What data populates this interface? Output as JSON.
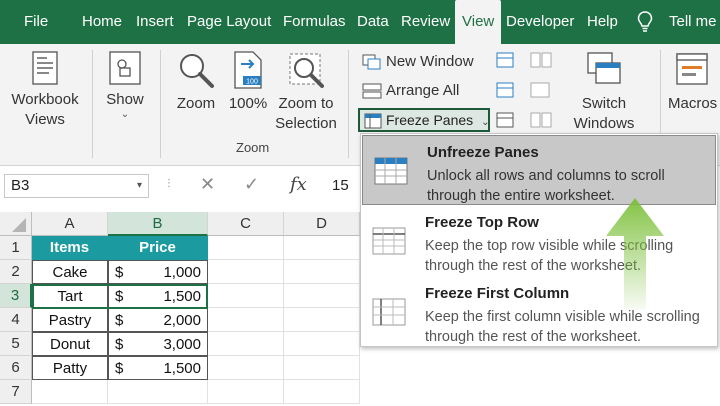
{
  "tabs": [
    "File",
    "Home",
    "Insert",
    "Page Layout",
    "Formulas",
    "Data",
    "Review",
    "View",
    "Developer",
    "Help",
    "Tell me"
  ],
  "ribbon": {
    "workbook_views": "Workbook\nViews",
    "show": "Show",
    "zoom": "Zoom",
    "zoom100": "100%",
    "zoom_to_selection": "Zoom to\nSelection",
    "zoom_group": "Zoom",
    "new_window": "New Window",
    "arrange_all": "Arrange All",
    "freeze_panes": "Freeze Panes",
    "switch_windows": "Switch\nWindows",
    "macros": "Macros"
  },
  "formula_bar": {
    "name_box": "B3",
    "value": "15"
  },
  "columns": [
    "A",
    "B",
    "C",
    "D"
  ],
  "rows": [
    "1",
    "2",
    "3",
    "4",
    "5",
    "6",
    "7"
  ],
  "table": {
    "header_items": "Items",
    "header_price": "Price",
    "currency": "$",
    "data": [
      {
        "item": "Cake",
        "price": "1,000"
      },
      {
        "item": "Tart",
        "price": "1,500"
      },
      {
        "item": "Pastry",
        "price": "2,000"
      },
      {
        "item": "Donut",
        "price": "3,000"
      },
      {
        "item": "Patty",
        "price": "1,500"
      }
    ]
  },
  "menu": [
    {
      "title": "Unfreeze Panes",
      "desc": "Unlock all rows and columns to scroll through the entire worksheet."
    },
    {
      "title": "Freeze Top Row",
      "desc": "Keep the top row visible while scrolling through the rest of the worksheet."
    },
    {
      "title": "Freeze First Column",
      "desc": "Keep the first column visible while scrolling through the rest of the worksheet."
    }
  ],
  "colors": {
    "ribbon_green": "#1e7145",
    "header_teal": "#1b9aa0",
    "arrow_green": "#8dc63f"
  },
  "icons": [
    "lightbulb-icon",
    "workbook-views-icon",
    "show-icon",
    "zoom-icon",
    "zoom-100-icon",
    "zoom-to-selection-icon",
    "new-window-icon",
    "arrange-all-icon",
    "freeze-panes-icon",
    "switch-windows-icon",
    "macros-icon",
    "fx-icon"
  ]
}
